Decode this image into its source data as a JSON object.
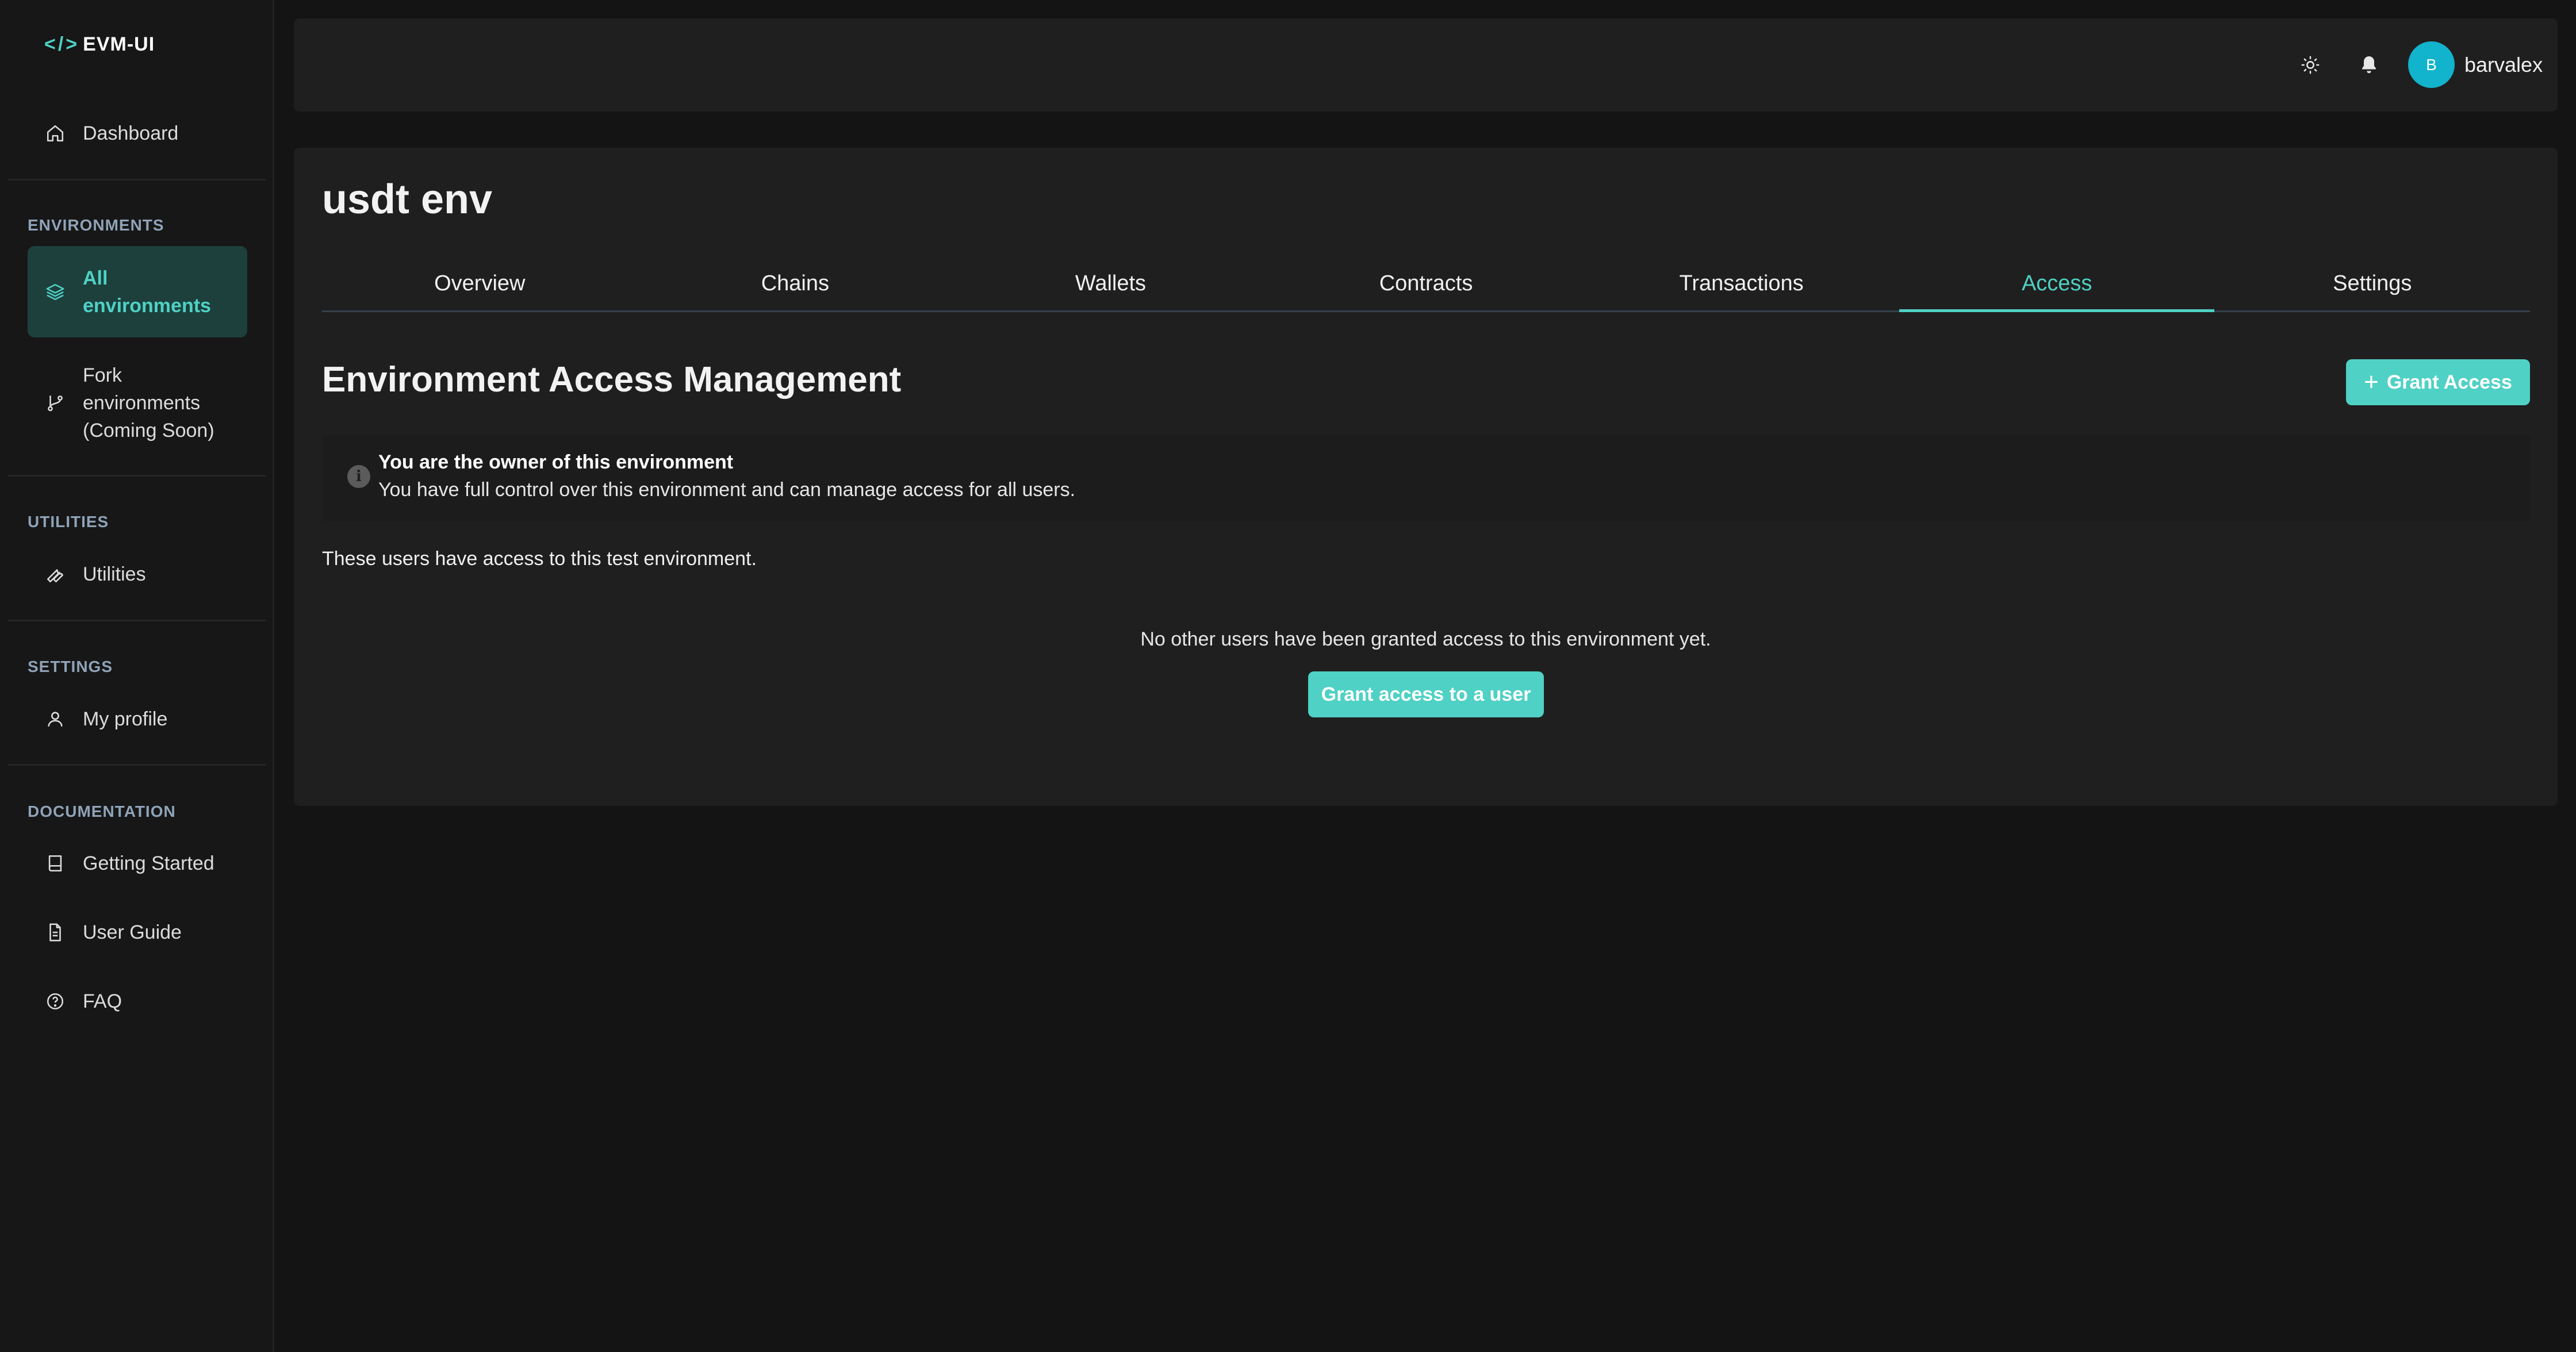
{
  "app": {
    "logo_code": "</>",
    "logo_name": "EVM-UI"
  },
  "sidebar": {
    "dashboard": "Dashboard",
    "environments_label": "ENVIRONMENTS",
    "all_environments": "All environments",
    "fork_environments": "Fork environments (Coming Soon)",
    "utilities_label": "UTILITIES",
    "utilities": "Utilities",
    "settings_label": "SETTINGS",
    "my_profile": "My profile",
    "documentation_label": "DOCUMENTATION",
    "getting_started": "Getting Started",
    "user_guide": "User Guide",
    "faq": "FAQ"
  },
  "header": {
    "avatar_initial": "B",
    "username": "barvalex"
  },
  "main": {
    "env_title": "usdt env",
    "tabs": [
      "Overview",
      "Chains",
      "Wallets",
      "Contracts",
      "Transactions",
      "Access",
      "Settings"
    ],
    "active_tab": "Access",
    "section_title": "Environment Access Management",
    "grant_button": "Grant Access",
    "owner_title": "You are the owner of this environment",
    "owner_desc": "You have full control over this environment and can manage access for all users.",
    "users_text": "These users have access to this test environment.",
    "empty_text": "No other users have been granted access to this environment yet.",
    "grant_user_button": "Grant access to a user"
  },
  "colors": {
    "accent": "#4fd1c5",
    "active_nav_bg": "#1d403d",
    "avatar": "#12b3cc"
  }
}
